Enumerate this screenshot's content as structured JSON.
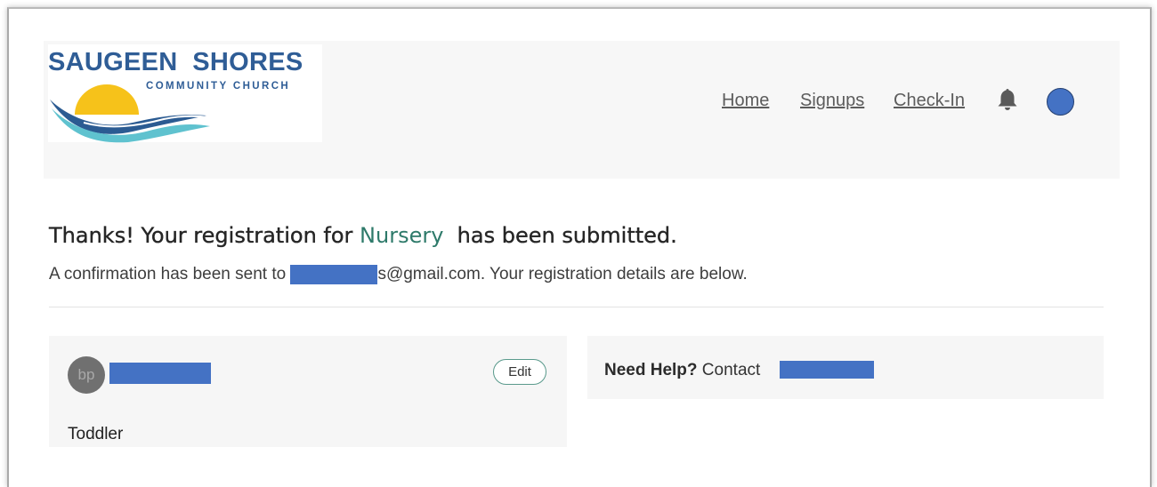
{
  "logo": {
    "line1": "SAUGEEN  SHORES",
    "line2": "COMMUNITY CHURCH"
  },
  "nav": {
    "items": [
      {
        "label": "Home"
      },
      {
        "label": "Signups"
      },
      {
        "label": "Check-In"
      }
    ],
    "bell_icon": "bell-icon",
    "avatar_icon": "user-avatar"
  },
  "confirmation": {
    "heading_prefix": "Thanks! Your registration for ",
    "program": "Nursery",
    "heading_suffix": "  has been submitted.",
    "line_prefix": "A confirmation has been sent to ",
    "line_email_suffix": "s@gmail.com. Your registration details are below."
  },
  "registrant": {
    "initials": "bp",
    "edit_label": "Edit",
    "level": "Toddler"
  },
  "help": {
    "label": "Need Help?",
    "text": " Contact "
  },
  "colors": {
    "accent": "#2e7a6a",
    "redaction": "#4472c4",
    "brand": "#2f5d96"
  }
}
